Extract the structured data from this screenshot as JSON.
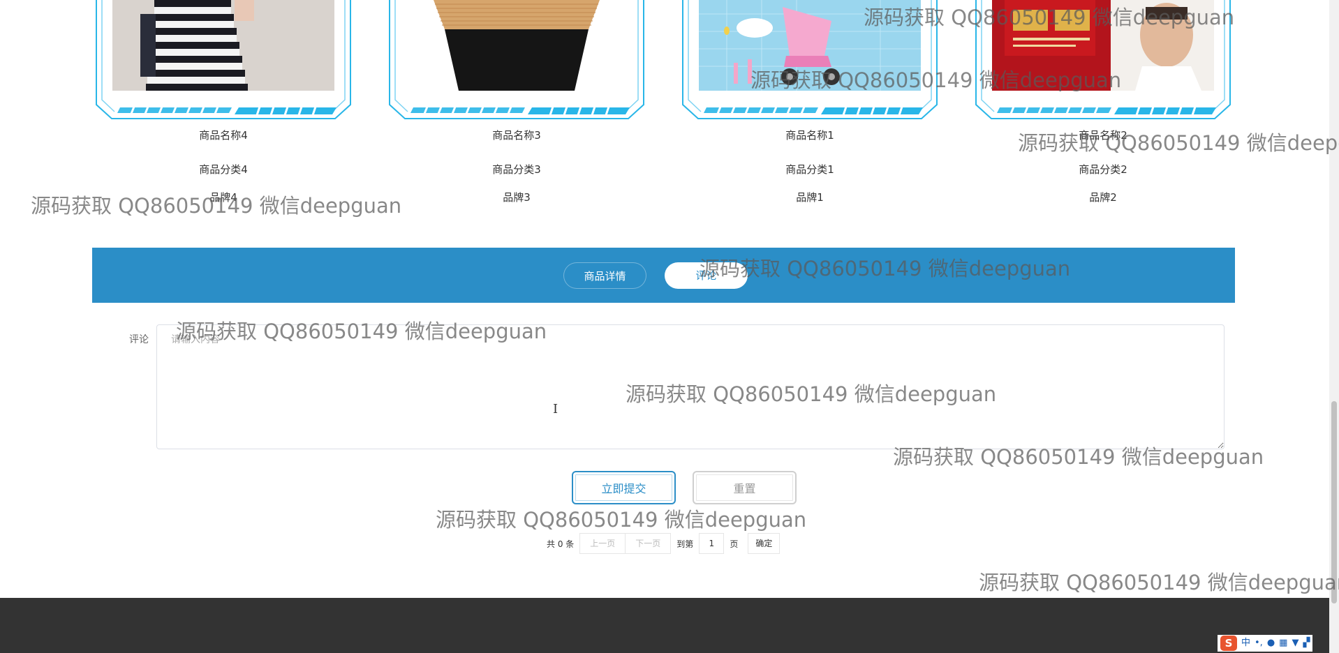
{
  "products": [
    {
      "name": "商品名称4",
      "category": "商品分类4",
      "brand": "品牌4",
      "image": "striped-dress-photo"
    },
    {
      "name": "商品名称3",
      "category": "商品分类3",
      "brand": "品牌3",
      "image": "knit-skirt-photo"
    },
    {
      "name": "商品名称1",
      "category": "商品分类1",
      "brand": "品牌1",
      "image": "pink-stroller-photo"
    },
    {
      "name": "商品名称2",
      "category": "商品分类2",
      "brand": "品牌2",
      "image": "book-cover-photo"
    }
  ],
  "tabs": {
    "detail_label": "商品详情",
    "comment_label": "评论",
    "active": "comment"
  },
  "comment_form": {
    "label": "评论",
    "placeholder": "请输入内容",
    "value": "",
    "submit_label": "立即提交",
    "reset_label": "重置"
  },
  "pagination": {
    "total_text": "共 0 条",
    "prev_label": "上一页",
    "next_label": "下一页",
    "goto_prefix": "到第",
    "page_value": "1",
    "page_suffix": "页",
    "confirm_label": "确定"
  },
  "watermark_text": "源码获取 QQ86050149 微信deepguan",
  "ime": {
    "logo": "S",
    "mode": "中",
    "punct": "•,"
  },
  "colors": {
    "tab_bar": "#2b8ec7",
    "accent": "#2b8ec7",
    "frame": "#29b6e8",
    "footer": "#333333"
  }
}
